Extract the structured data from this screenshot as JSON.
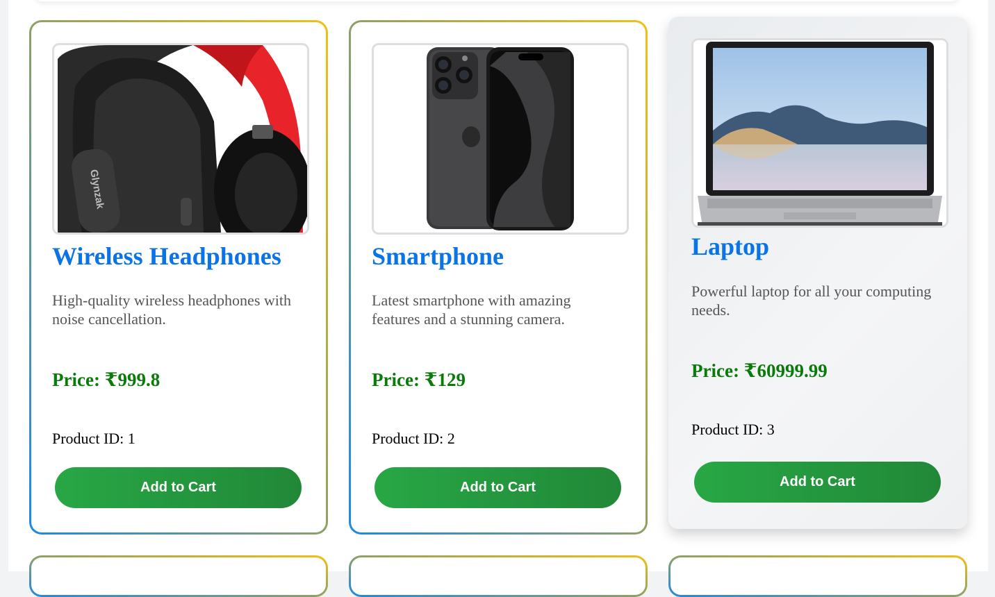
{
  "products": [
    {
      "title": "Wireless Headphones",
      "description": "High-quality wireless headphones with noise cancellation.",
      "price": "Price: ₹999.8",
      "product_id": "Product ID: 1",
      "button": "Add to Cart",
      "brand_text": "Glynzak"
    },
    {
      "title": "Smartphone",
      "description": "Latest smartphone with amazing features and a stunning camera.",
      "price": "Price: ₹129",
      "product_id": "Product ID: 2",
      "button": "Add to Cart"
    },
    {
      "title": "Laptop",
      "description": "Powerful laptop for all your computing needs.",
      "price": "Price: ₹60999.99",
      "product_id": "Product ID: 3",
      "button": "Add to Cart"
    }
  ],
  "colors": {
    "title": "#0a73e6",
    "price": "#0a7a0a",
    "button": "#28a745",
    "border_gradient_start": "#1e88e5",
    "border_gradient_end": "#f2c012"
  }
}
